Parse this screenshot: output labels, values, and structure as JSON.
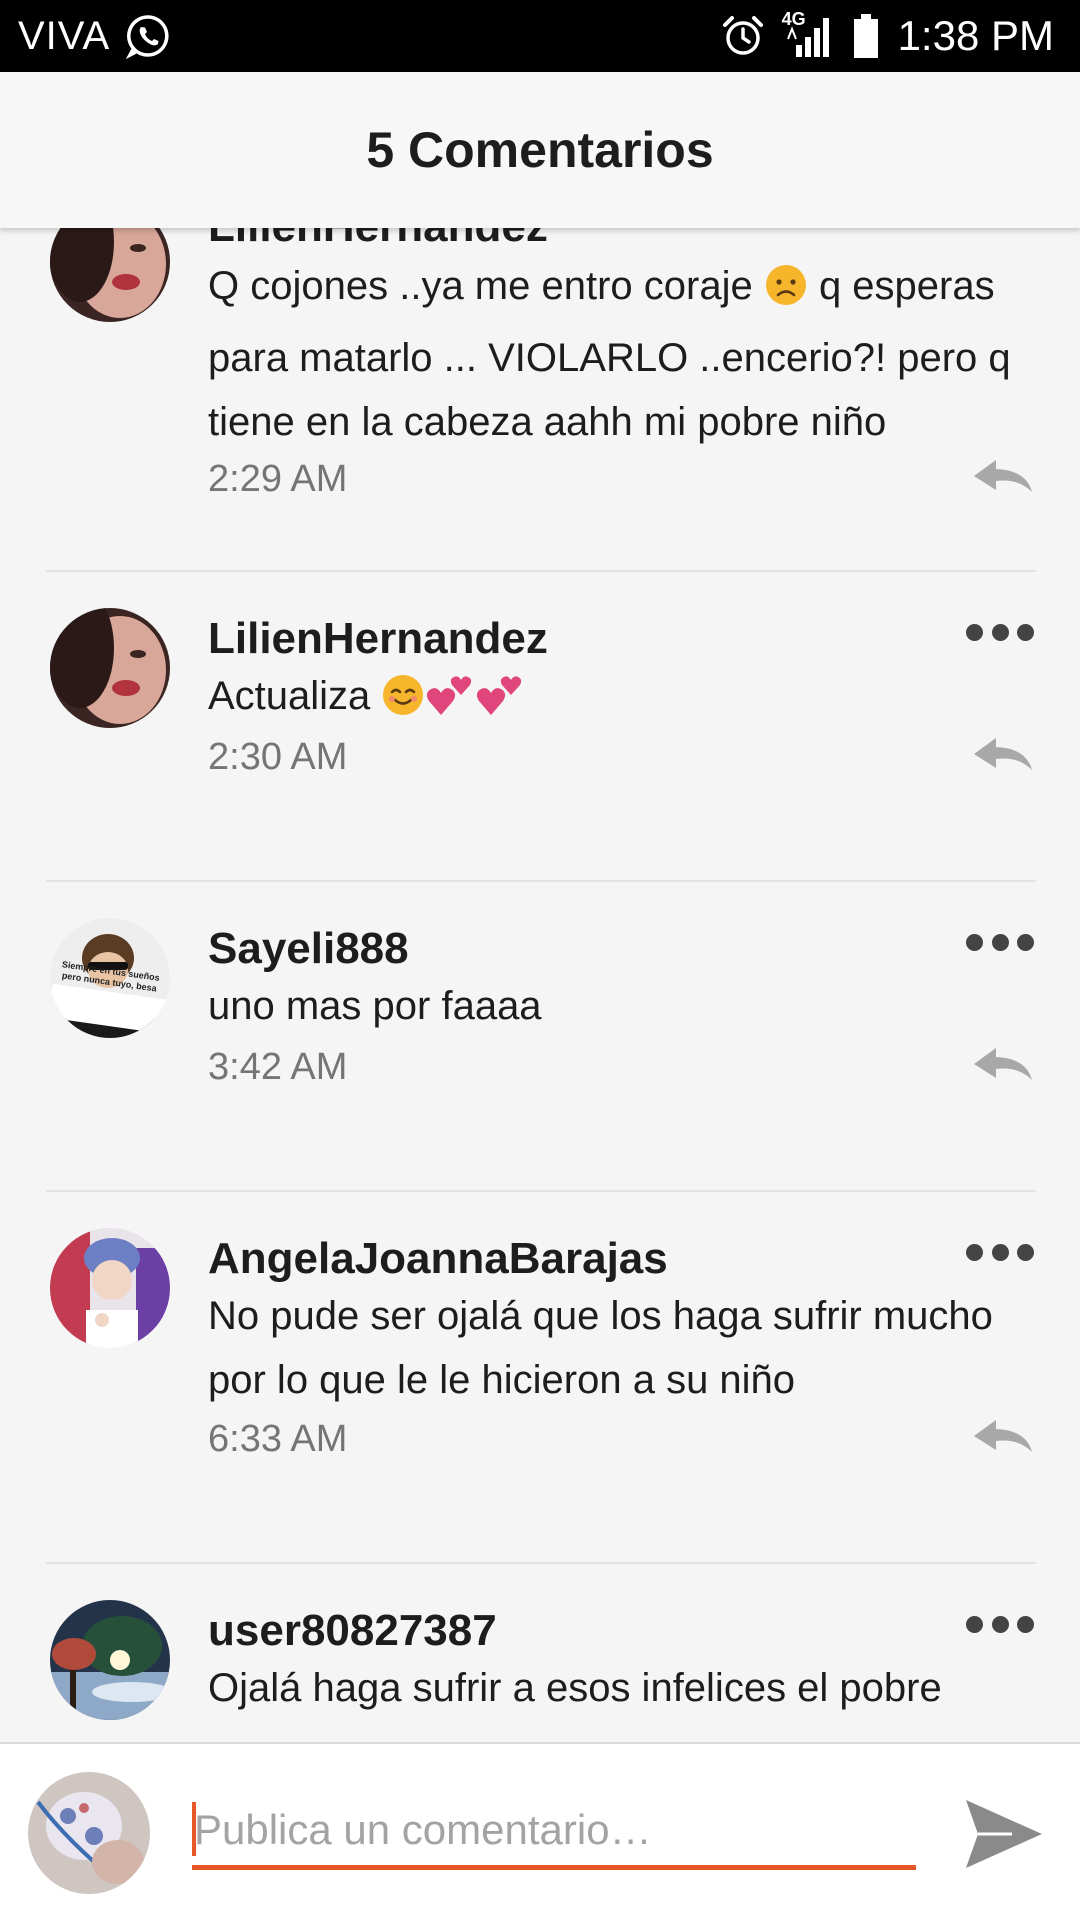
{
  "status_bar": {
    "carrier": "VIVA",
    "network": "4G",
    "time": "1:38 PM"
  },
  "header": {
    "title": "5 Comentarios"
  },
  "comments": [
    {
      "author": "LilienHernandez",
      "body_before": "Q cojones ..ya me entro coraje ",
      "body_after": " q esperas para matarlo ... VIOLARLO ..encerio?! pero q tiene en la cabeza aahh mi pobre niño",
      "time": "2:29 AM",
      "avatar": "avatar-photo"
    },
    {
      "author": "LilienHernandez",
      "body_before": "Actualiza ",
      "body_after": "",
      "time": "2:30 AM",
      "avatar": "avatar-photo"
    },
    {
      "author": "Sayeli888",
      "body_before": "uno mas por faaaa",
      "body_after": "",
      "time": "3:42 AM",
      "avatar": "avatar-photo"
    },
    {
      "author": "AngelaJoannaBarajas",
      "body_before": "No pude ser ojalá que los haga sufrir mucho por lo que le le hicieron a su niño",
      "body_after": "",
      "time": "6:33 AM",
      "avatar": "avatar-photo"
    },
    {
      "author": "user80827387",
      "body_before": "Ojalá haga sufrir a esos infelices el pobre",
      "body_after": "",
      "time": "",
      "avatar": "avatar-photo"
    }
  ],
  "avatar_sticker_text": "Siempre en tus sueños pero nunca tuyo, besa",
  "input": {
    "placeholder": "Publica un comentario…",
    "value": ""
  },
  "icons": {
    "whatsapp": "whatsapp-icon",
    "alarm": "alarm-icon",
    "signal": "signal-icon",
    "battery": "battery-icon",
    "more": "more-options-icon",
    "reply": "reply-icon",
    "send": "send-icon"
  },
  "colors": {
    "accent": "#e8572a",
    "text": "#1d1d1d",
    "meta": "#757575",
    "background": "#f5f5f5"
  }
}
